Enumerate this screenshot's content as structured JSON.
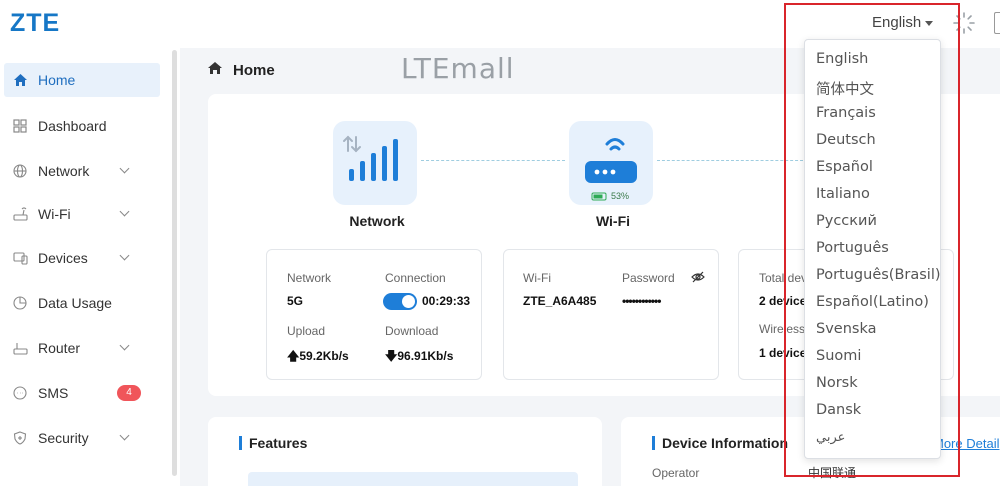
{
  "header": {
    "logo": "ZTE",
    "language": "English"
  },
  "sidebar": {
    "items": [
      {
        "label": "Home"
      },
      {
        "label": "Dashboard"
      },
      {
        "label": "Network"
      },
      {
        "label": "Wi-Fi"
      },
      {
        "label": "Devices"
      },
      {
        "label": "Data Usage"
      },
      {
        "label": "Router"
      },
      {
        "label": "SMS",
        "badge": "4"
      },
      {
        "label": "Security"
      }
    ]
  },
  "breadcrumb": {
    "title": "Home"
  },
  "watermark": "LTEmall",
  "status": {
    "network_tile": {
      "label": "Network"
    },
    "wifi_tile": {
      "label": "Wi-Fi",
      "battery": "53%"
    },
    "network_box": {
      "network_label": "Network",
      "network_value": "5G",
      "connection_label": "Connection",
      "connection_time": "00:29:33",
      "upload_label": "Upload",
      "upload_value": "59.2Kb/s",
      "download_label": "Download",
      "download_value": "96.91Kb/s"
    },
    "wifi_box": {
      "wifi_label": "Wi-Fi",
      "wifi_value": "ZTE_A6A485",
      "password_label": "Password",
      "password_value": "••••••••••••"
    },
    "devices_box": {
      "total_label": "Total dev",
      "total_value": "2 device",
      "wireless_label": "Wireless",
      "wireless_value": "1 device"
    }
  },
  "features": {
    "title": "Features"
  },
  "device_info": {
    "title": "Device Information",
    "more": "More Detail",
    "operator_label": "Operator",
    "operator_value": "中国联通"
  },
  "language_menu": [
    "English",
    "简体中文",
    "Français",
    "Deutsch",
    "Español",
    "Italiano",
    "Русский",
    "Português",
    "Português(Brasil)",
    "Español(Latino)",
    "Svenska",
    "Suomi",
    "Norsk",
    "Dansk",
    "عربي"
  ],
  "colors": {
    "accent": "#1e7ed8",
    "highlight_frame": "#d9252b",
    "badge": "#f0555a"
  }
}
